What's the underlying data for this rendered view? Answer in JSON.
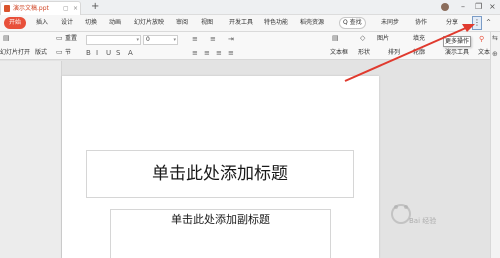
{
  "titlebar": {
    "doc_name": "演示文稿.ppt",
    "ppt_badge_label": "P",
    "phone_icon": "phone-icon",
    "close_tab": "×",
    "new_tab": "+",
    "minimize": "–",
    "restore": "❐",
    "close": "×"
  },
  "menubar": {
    "start": "开始",
    "items": [
      "插入",
      "设计",
      "切换",
      "动画",
      "幻灯片放映",
      "审阅",
      "视图",
      "开发工具",
      "特色功能",
      "稻壳资源"
    ],
    "search": "Q 查找",
    "sync": "未同步",
    "collab": "协作",
    "share": "分享",
    "more": "⋮",
    "collapse": "^"
  },
  "ribbon": {
    "play_slides": "幻灯片打开",
    "new_style": "版式",
    "reset": "重置",
    "section": "节",
    "font_size": "0",
    "text_box": "文本框",
    "shape": "形状",
    "arrange": "排列",
    "picture": "图片",
    "fill": "填充",
    "outline": "轮廓",
    "presenter": "演示工具",
    "textbox2": "文本框"
  },
  "tooltip": "更多操作",
  "slide": {
    "title_placeholder": "单击此处添加标题",
    "subtitle_placeholder": "单击此处添加副标题"
  },
  "watermark": "Bai 经验",
  "colors": {
    "accent": "#e8503a",
    "arrow": "#e03a2e"
  }
}
